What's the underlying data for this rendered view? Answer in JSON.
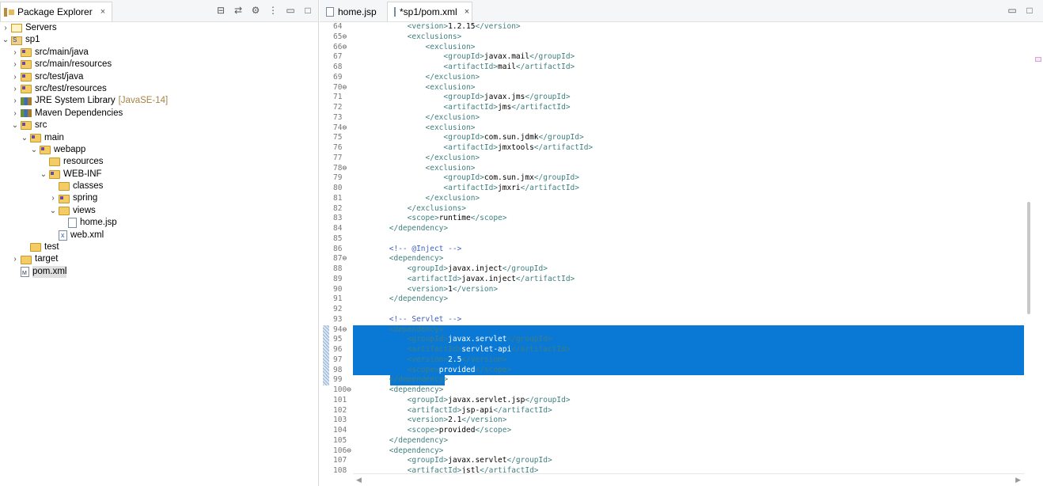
{
  "explorer": {
    "tab_label": "Package Explorer",
    "tab_close": "×",
    "toolbar_icons": [
      "collapse-all-icon",
      "link-with-editor-icon",
      "filter-icon",
      "view-menu-icon",
      "minimize-icon",
      "maximize-icon"
    ],
    "tree": [
      {
        "indent": 0,
        "twisty": ">",
        "icon": "server",
        "label": "Servers",
        "decor": ""
      },
      {
        "indent": 0,
        "twisty": "v",
        "icon": "project",
        "label": "sp1",
        "decor": ""
      },
      {
        "indent": 1,
        "twisty": ">",
        "icon": "srcfolder",
        "label": "src/main/java",
        "decor": ""
      },
      {
        "indent": 1,
        "twisty": ">",
        "icon": "srcfolder",
        "label": "src/main/resources",
        "decor": ""
      },
      {
        "indent": 1,
        "twisty": ">",
        "icon": "srcfolder",
        "label": "src/test/java",
        "decor": ""
      },
      {
        "indent": 1,
        "twisty": ">",
        "icon": "srcfolder",
        "label": "src/test/resources",
        "decor": ""
      },
      {
        "indent": 1,
        "twisty": ">",
        "icon": "library",
        "label": "JRE System Library",
        "decor": "[JavaSE-14]"
      },
      {
        "indent": 1,
        "twisty": ">",
        "icon": "library",
        "label": "Maven Dependencies",
        "decor": ""
      },
      {
        "indent": 1,
        "twisty": "v",
        "icon": "srcfolder",
        "label": "src",
        "decor": ""
      },
      {
        "indent": 2,
        "twisty": "v",
        "icon": "srcfolder",
        "label": "main",
        "decor": ""
      },
      {
        "indent": 3,
        "twisty": "v",
        "icon": "srcfolder",
        "label": "webapp",
        "decor": ""
      },
      {
        "indent": 4,
        "twisty": "",
        "icon": "folder",
        "label": "resources",
        "decor": ""
      },
      {
        "indent": 4,
        "twisty": "v",
        "icon": "srcfolder",
        "label": "WEB-INF",
        "decor": ""
      },
      {
        "indent": 5,
        "twisty": "",
        "icon": "folder",
        "label": "classes",
        "decor": ""
      },
      {
        "indent": 5,
        "twisty": ">",
        "icon": "srcfolder",
        "label": "spring",
        "decor": ""
      },
      {
        "indent": 5,
        "twisty": "v",
        "icon": "folder",
        "label": "views",
        "decor": ""
      },
      {
        "indent": 6,
        "twisty": "",
        "icon": "file",
        "label": "home.jsp",
        "decor": ""
      },
      {
        "indent": 5,
        "twisty": "",
        "icon": "xmlfile",
        "label": "web.xml",
        "decor": ""
      },
      {
        "indent": 2,
        "twisty": "",
        "icon": "folder",
        "label": "test",
        "decor": ""
      },
      {
        "indent": 1,
        "twisty": ">",
        "icon": "folder",
        "label": "target",
        "decor": ""
      },
      {
        "indent": 1,
        "twisty": "",
        "icon": "pomfile",
        "label": "pom.xml",
        "decor": "",
        "selected": true
      }
    ]
  },
  "editor": {
    "tabs": [
      {
        "label": "home.jsp",
        "active": false
      },
      {
        "label": "*sp1/pom.xml",
        "active": true,
        "close": "×"
      }
    ],
    "lines": [
      {
        "n": "64",
        "fold": false,
        "text": "            <version>1.2.15</version>"
      },
      {
        "n": "65",
        "fold": true,
        "text": "            <exclusions>"
      },
      {
        "n": "66",
        "fold": true,
        "text": "                <exclusion>"
      },
      {
        "n": "67",
        "fold": false,
        "text": "                    <groupId>javax.mail</groupId>"
      },
      {
        "n": "68",
        "fold": false,
        "text": "                    <artifactId>mail</artifactId>"
      },
      {
        "n": "69",
        "fold": false,
        "text": "                </exclusion>"
      },
      {
        "n": "70",
        "fold": true,
        "text": "                <exclusion>"
      },
      {
        "n": "71",
        "fold": false,
        "text": "                    <groupId>javax.jms</groupId>"
      },
      {
        "n": "72",
        "fold": false,
        "text": "                    <artifactId>jms</artifactId>"
      },
      {
        "n": "73",
        "fold": false,
        "text": "                </exclusion>"
      },
      {
        "n": "74",
        "fold": true,
        "text": "                <exclusion>"
      },
      {
        "n": "75",
        "fold": false,
        "text": "                    <groupId>com.sun.jdmk</groupId>"
      },
      {
        "n": "76",
        "fold": false,
        "text": "                    <artifactId>jmxtools</artifactId>"
      },
      {
        "n": "77",
        "fold": false,
        "text": "                </exclusion>"
      },
      {
        "n": "78",
        "fold": true,
        "text": "                <exclusion>"
      },
      {
        "n": "79",
        "fold": false,
        "text": "                    <groupId>com.sun.jmx</groupId>"
      },
      {
        "n": "80",
        "fold": false,
        "text": "                    <artifactId>jmxri</artifactId>"
      },
      {
        "n": "81",
        "fold": false,
        "text": "                </exclusion>"
      },
      {
        "n": "82",
        "fold": false,
        "text": "            </exclusions>"
      },
      {
        "n": "83",
        "fold": false,
        "text": "            <scope>runtime</scope>"
      },
      {
        "n": "84",
        "fold": false,
        "text": "        </dependency>"
      },
      {
        "n": "85",
        "fold": false,
        "text": ""
      },
      {
        "n": "86",
        "fold": false,
        "text": "        <!-- @Inject -->"
      },
      {
        "n": "87",
        "fold": true,
        "text": "        <dependency>"
      },
      {
        "n": "88",
        "fold": false,
        "text": "            <groupId>javax.inject</groupId>"
      },
      {
        "n": "89",
        "fold": false,
        "text": "            <artifactId>javax.inject</artifactId>"
      },
      {
        "n": "90",
        "fold": false,
        "text": "            <version>1</version>"
      },
      {
        "n": "91",
        "fold": false,
        "text": "        </dependency>"
      },
      {
        "n": "92",
        "fold": false,
        "text": ""
      },
      {
        "n": "93",
        "fold": false,
        "text": "        <!-- Servlet -->"
      },
      {
        "n": "94",
        "fold": true,
        "text": "        <dependency>",
        "sel": "full"
      },
      {
        "n": "95",
        "fold": false,
        "text": "            <groupId>javax.servlet</groupId>",
        "sel": "full"
      },
      {
        "n": "96",
        "fold": false,
        "text": "            <artifactId>servlet-api</artifactId>",
        "sel": "full"
      },
      {
        "n": "97",
        "fold": false,
        "text": "            <version>2.5</version>",
        "sel": "full"
      },
      {
        "n": "98",
        "fold": false,
        "text": "            <scope>provided</scope>",
        "sel": "full"
      },
      {
        "n": "99",
        "fold": false,
        "text": "        </dependency>",
        "sel": "partial"
      },
      {
        "n": "100",
        "fold": true,
        "text": "        <dependency>"
      },
      {
        "n": "101",
        "fold": false,
        "text": "            <groupId>javax.servlet.jsp</groupId>"
      },
      {
        "n": "102",
        "fold": false,
        "text": "            <artifactId>jsp-api</artifactId>"
      },
      {
        "n": "103",
        "fold": false,
        "text": "            <version>2.1</version>"
      },
      {
        "n": "104",
        "fold": false,
        "text": "            <scope>provided</scope>"
      },
      {
        "n": "105",
        "fold": false,
        "text": "        </dependency>"
      },
      {
        "n": "106",
        "fold": true,
        "text": "        <dependency>"
      },
      {
        "n": "107",
        "fold": false,
        "text": "            <groupId>javax.servlet</groupId>"
      },
      {
        "n": "108",
        "fold": false,
        "text": "            <artifactId>jstl</artifactId>"
      }
    ]
  }
}
